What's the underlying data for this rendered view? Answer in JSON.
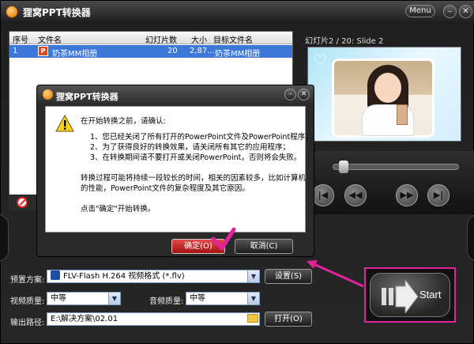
{
  "app": {
    "title": "狸窝PPT转换器",
    "menu_label": "Menu",
    "min_glyph": "–",
    "close_glyph": "✕"
  },
  "file_table": {
    "columns": [
      "序号",
      "文件名",
      "幻灯片数",
      "大小",
      "目标文件名"
    ],
    "rows": [
      {
        "index": "1",
        "filename": "奶茶MM相册",
        "slides": "20",
        "size": "2,87...",
        "target": "奶茶MM相册"
      }
    ]
  },
  "preview": {
    "label": "幻灯片2 / 20: Slide 2"
  },
  "player": {
    "controls": [
      "rewind",
      "fast-rewind",
      "fast-forward",
      "skip"
    ],
    "position_fraction": 0.04
  },
  "settings": {
    "preset_label": "预置方案:",
    "preset_value": "FLV-Flash H.264 视频格式 (*.flv)",
    "settings_button": "设置(S)",
    "video_quality_label": "视频质量:",
    "video_quality_value": "中等",
    "audio_quality_label": "音频质量:",
    "audio_quality_value": "中等",
    "output_label": "输出路径:",
    "output_value": "E:\\解决方案\\02.01",
    "open_button": "打开(O)"
  },
  "start": {
    "label": "Start"
  },
  "dialog": {
    "title": "狸窝PPT转换器",
    "lines": [
      "在开始转换之前，请确认:",
      "1、您已经关闭了所有打开的PowerPoint文件及PowerPoint程序；",
      "2、为了获得良好的转换效果，请关闭所有其它的应用程序；",
      "3、在转换期间请不要打开或关闭PowerPoint，否则将会失败。",
      "转换过程可能将持续一段较长的时间，相关的因素较多，比如计算机",
      "的性能，PowerPoint文件的复杂程度及其它原因。",
      "点击\"确定\"开始转换。"
    ],
    "ok_button": "确定(O)",
    "cancel_button": "取消(C)"
  },
  "colors": {
    "accent": "#e3239b",
    "selection": "#3b78d8",
    "ok_red": "#c41f1f"
  }
}
